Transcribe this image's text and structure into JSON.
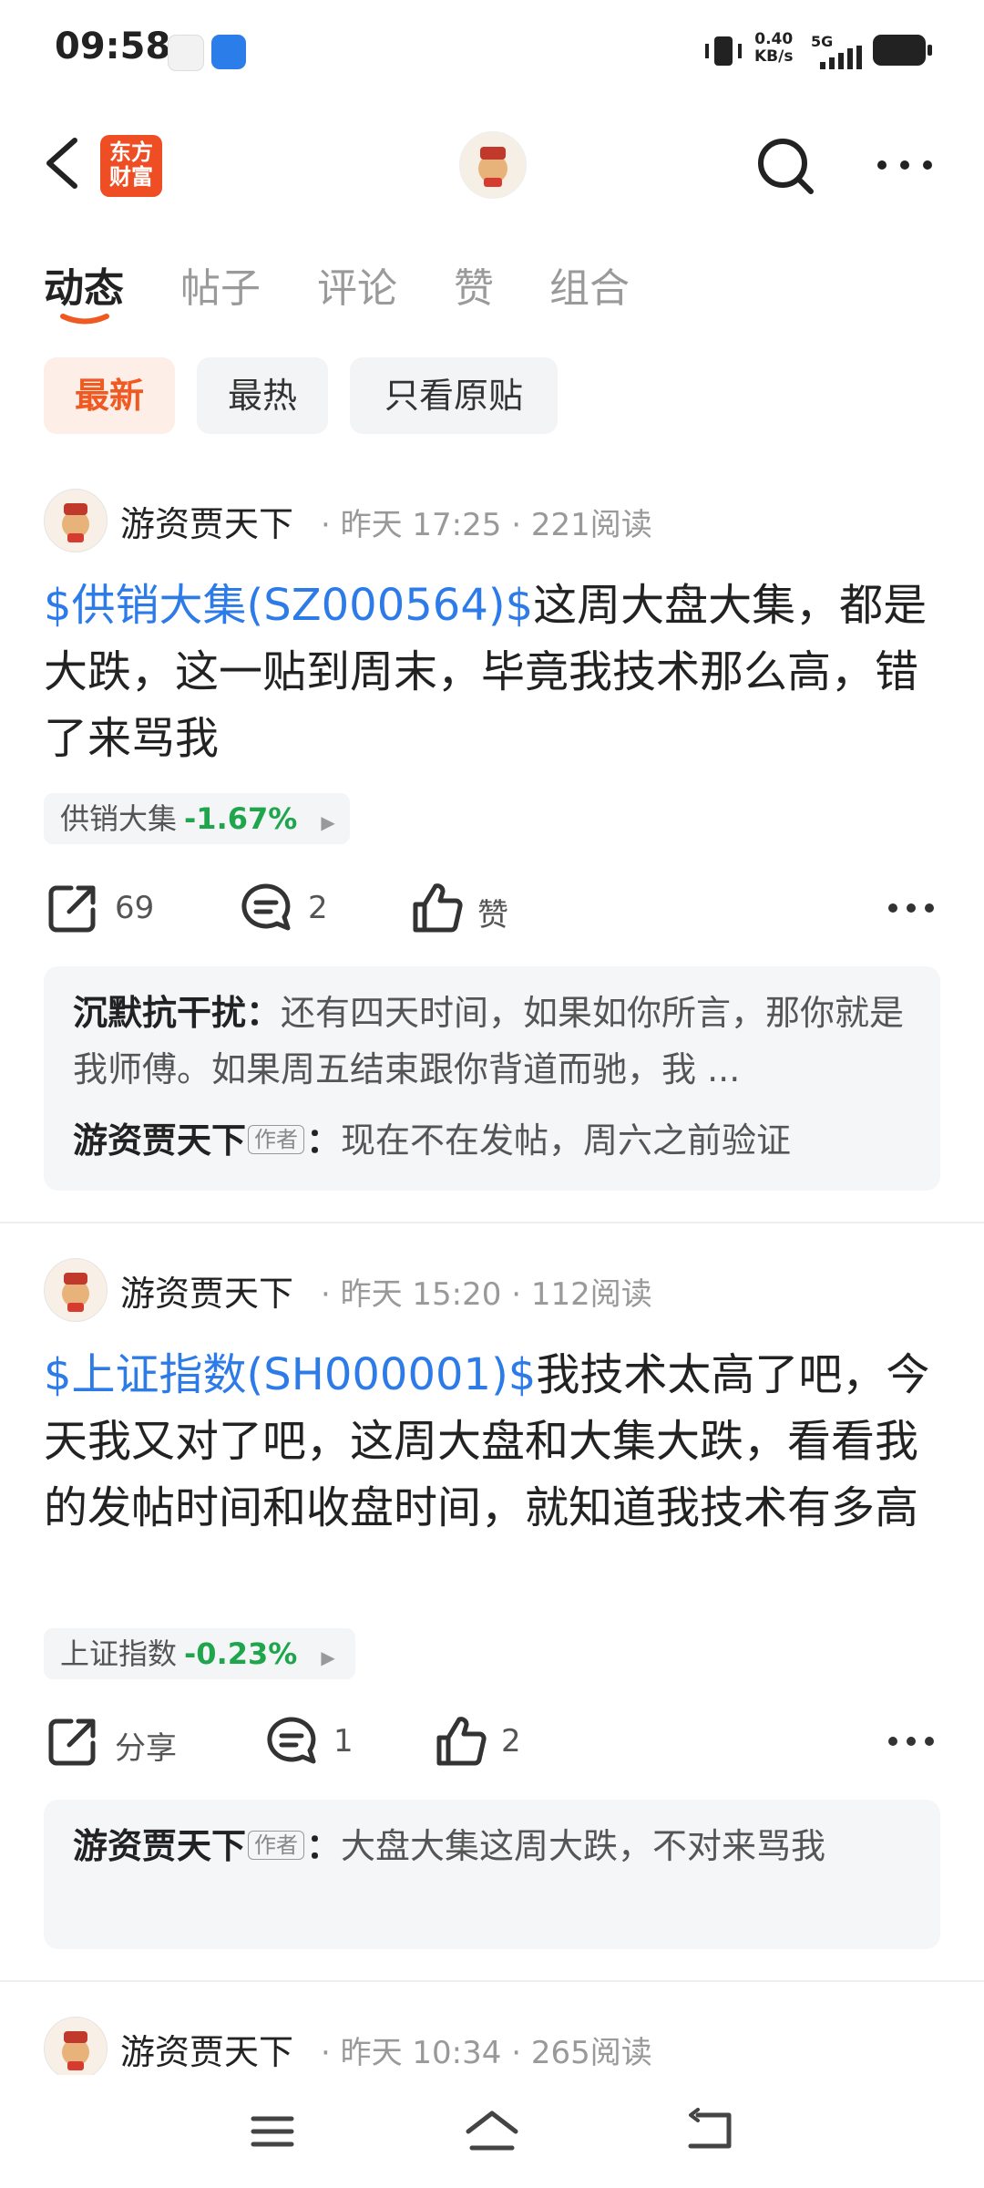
{
  "status_bar": {
    "time": "09:58",
    "net_speed_value": "0.40",
    "net_speed_unit": "KB/s",
    "signal_type": "5G"
  },
  "header": {
    "logo_line1": "东方",
    "logo_line2": "财富"
  },
  "tabs": [
    "动态",
    "帖子",
    "评论",
    "赞",
    "组合"
  ],
  "filters": [
    "最新",
    "最热",
    "只看原贴"
  ],
  "posts": [
    {
      "author": "游资贾天下",
      "meta": "· 昨天 17:25 · 221阅读",
      "stock_link": "$供销大集(SZ000564)$",
      "text": "这周大盘大集，都是大跌，这一贴到周末，毕竟我技术那么高，错了来骂我",
      "stock_tag": {
        "name": "供销大集",
        "change": "-1.67%"
      },
      "share_label": "69",
      "comment_count": "2",
      "like_label": "赞",
      "comments": [
        {
          "author": "沉默抗干扰",
          "text": "还有四天时间，如果如你所言，那你就是我师傅。如果周五结束跟你背道而驰，我 ..."
        },
        {
          "author": "游资贾天下",
          "badge": "作者",
          "text": "现在不在发帖，周六之前验证"
        }
      ]
    },
    {
      "author": "游资贾天下",
      "meta": "· 昨天 15:20 · 112阅读",
      "stock_link": "$上证指数(SH000001)$",
      "text": "我技术太高了吧，今天我又对了吧，这周大盘和大集大跌，看看我的发帖时间和收盘时间，就知道我技术有多高",
      "stock_tag": {
        "name": "上证指数",
        "change": "-0.23%"
      },
      "share_label": "分享",
      "comment_count": "1",
      "like_label": "2",
      "comments": [
        {
          "author": "游资贾天下",
          "badge": "作者",
          "text": "大盘大集这周大跌，不对来骂我"
        }
      ]
    },
    {
      "author": "游资贾天下",
      "meta": "· 昨天 10:34 · 265阅读"
    }
  ],
  "colors": {
    "brand_orange": "#ef4d23",
    "link_blue": "#2c7be8",
    "down_green": "#1fa64d",
    "chip_active_bg": "#fdeee7"
  }
}
